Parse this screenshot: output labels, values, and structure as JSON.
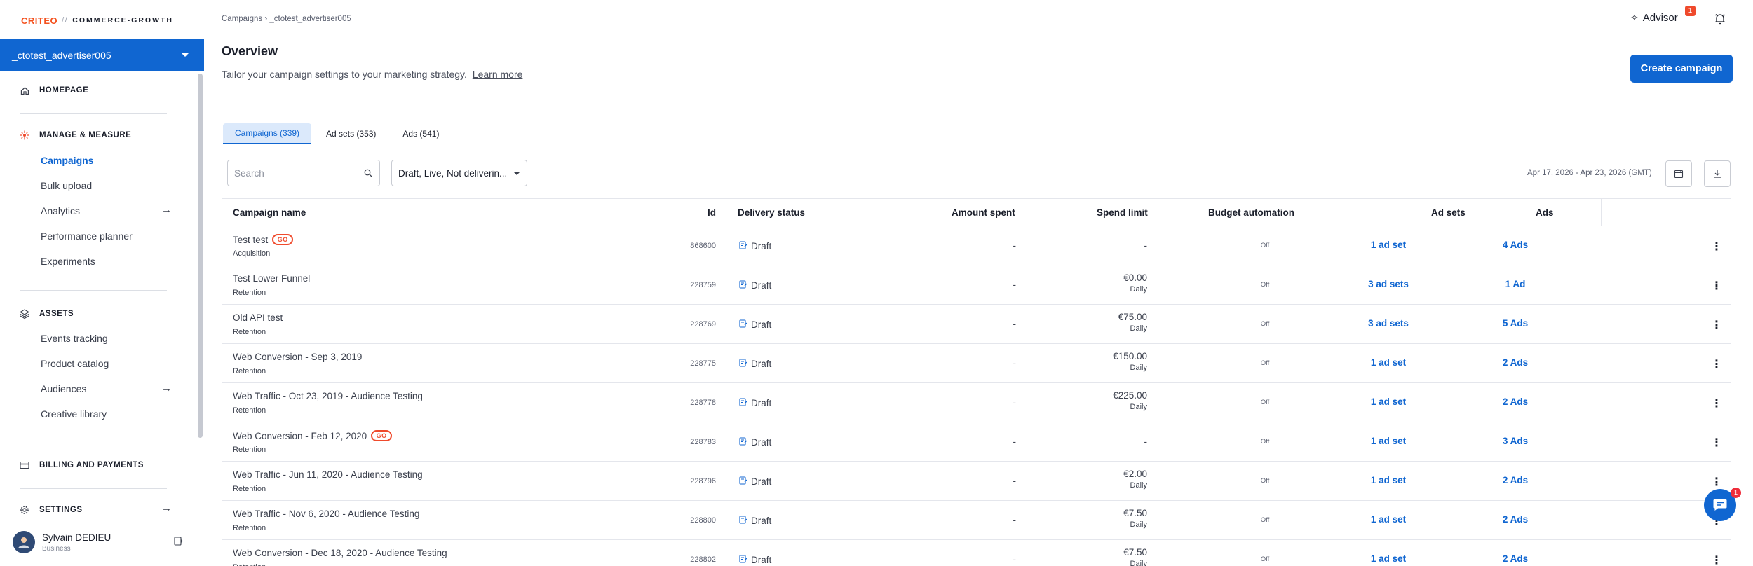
{
  "logo": {
    "brand": "CRITEO",
    "slash": "//",
    "product": "COMMERCE-GROWTH"
  },
  "advertiser": "_ctotest_advertiser005",
  "nav": {
    "homepage": "HOMEPAGE",
    "manage_measure": "MANAGE & MEASURE",
    "campaigns": "Campaigns",
    "bulk_upload": "Bulk upload",
    "analytics": "Analytics",
    "performance_planner": "Performance planner",
    "experiments": "Experiments",
    "assets": "ASSETS",
    "events_tracking": "Events tracking",
    "product_catalog": "Product catalog",
    "audiences": "Audiences",
    "creative_library": "Creative library",
    "billing": "BILLING AND PAYMENTS",
    "settings": "SETTINGS"
  },
  "user": {
    "name": "Sylvain DEDIEU",
    "role": "Business"
  },
  "breadcrumb": "Campaigns › _ctotest_advertiser005",
  "advisor": {
    "label": "Advisor",
    "badge": "1"
  },
  "page": {
    "title": "Overview",
    "subtitle": "Tailor your campaign settings to your marketing strategy.",
    "learn_more": "Learn more",
    "create_button": "Create campaign"
  },
  "tabs": [
    "Campaigns (339)",
    "Ad sets (353)",
    "Ads (541)"
  ],
  "filters": {
    "search_placeholder": "Search",
    "status_filter": "Draft, Live, Not deliverin...",
    "date_range": "Apr 17, 2026 - Apr 23, 2026 (GMT)"
  },
  "table": {
    "headers": {
      "name": "Campaign name",
      "id": "Id",
      "delivery": "Delivery status",
      "amount": "Amount spent",
      "spend": "Spend limit",
      "budget": "Budget automation",
      "adsets": "Ad sets",
      "ads": "Ads"
    },
    "rows": [
      {
        "name": "Test test",
        "go": true,
        "objective": "Acquisition",
        "id": "868600",
        "status": "Draft",
        "amount": "-",
        "spend": "-",
        "spend_period": "",
        "budget": "Off",
        "adsets": "1 ad set",
        "ads": "4 Ads"
      },
      {
        "name": "Test Lower Funnel",
        "go": false,
        "objective": "Retention",
        "id": "228759",
        "status": "Draft",
        "amount": "-",
        "spend": "€0.00",
        "spend_period": "Daily",
        "budget": "Off",
        "adsets": "3 ad sets",
        "ads": "1 Ad"
      },
      {
        "name": "Old API test",
        "go": false,
        "objective": "Retention",
        "id": "228769",
        "status": "Draft",
        "amount": "-",
        "spend": "€75.00",
        "spend_period": "Daily",
        "budget": "Off",
        "adsets": "3 ad sets",
        "ads": "5 Ads"
      },
      {
        "name": "Web Conversion - Sep 3, 2019",
        "go": false,
        "objective": "Retention",
        "id": "228775",
        "status": "Draft",
        "amount": "-",
        "spend": "€150.00",
        "spend_period": "Daily",
        "budget": "Off",
        "adsets": "1 ad set",
        "ads": "2 Ads"
      },
      {
        "name": "Web Traffic - Oct 23, 2019 - Audience Testing",
        "go": false,
        "objective": "Retention",
        "id": "228778",
        "status": "Draft",
        "amount": "-",
        "spend": "€225.00",
        "spend_period": "Daily",
        "budget": "Off",
        "adsets": "1 ad set",
        "ads": "2 Ads"
      },
      {
        "name": "Web Conversion - Feb 12, 2020",
        "go": true,
        "objective": "Retention",
        "id": "228783",
        "status": "Draft",
        "amount": "-",
        "spend": "-",
        "spend_period": "",
        "budget": "Off",
        "adsets": "1 ad set",
        "ads": "3 Ads"
      },
      {
        "name": "Web Traffic - Jun 11, 2020 - Audience Testing",
        "go": false,
        "objective": "Retention",
        "id": "228796",
        "status": "Draft",
        "amount": "-",
        "spend": "€2.00",
        "spend_period": "Daily",
        "budget": "Off",
        "adsets": "1 ad set",
        "ads": "2 Ads"
      },
      {
        "name": "Web Traffic - Nov 6, 2020 - Audience Testing",
        "go": false,
        "objective": "Retention",
        "id": "228800",
        "status": "Draft",
        "amount": "-",
        "spend": "€7.50",
        "spend_period": "Daily",
        "budget": "Off",
        "adsets": "1 ad set",
        "ads": "2 Ads"
      },
      {
        "name": "Web Conversion - Dec 18, 2020 - Audience Testing",
        "go": false,
        "objective": "Retention",
        "id": "228802",
        "status": "Draft",
        "amount": "-",
        "spend": "€7.50",
        "spend_period": "Daily",
        "budget": "Off",
        "adsets": "1 ad set",
        "ads": "2 Ads"
      }
    ]
  },
  "go_badge": "GO",
  "chat_badge": "1",
  "colors": {
    "primary": "#1066d1",
    "accent": "#ef4a2c",
    "text": "#1b1f2b"
  }
}
